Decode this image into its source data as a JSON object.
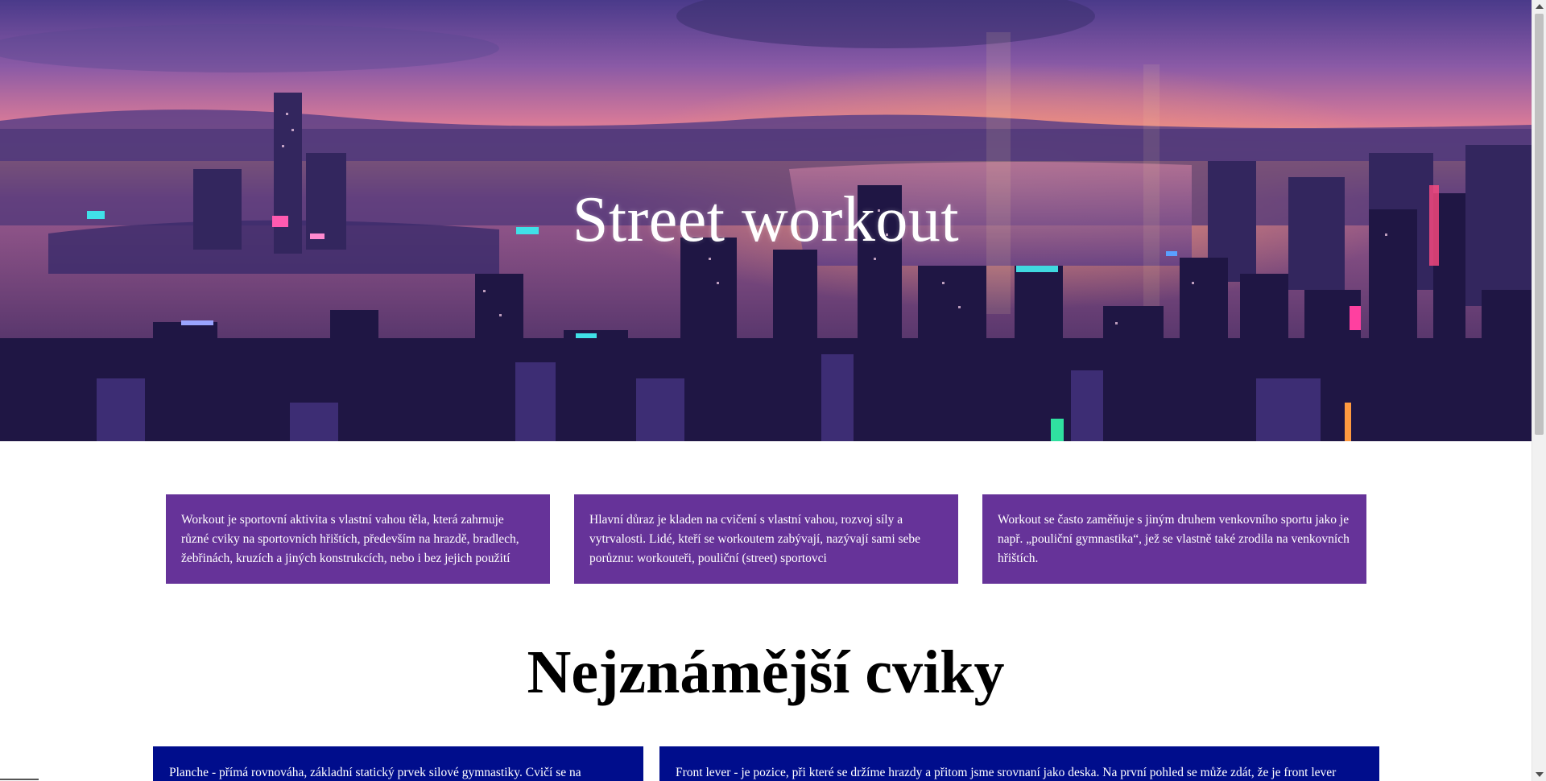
{
  "hero": {
    "title": "Street workout"
  },
  "intro_cards": [
    {
      "text": "Workout je sportovní aktivita s vlastní vahou těla, která zahrnuje různé cviky na sportovních hřištích, především na hrazdě, bradlech, žebřinách, kruzích a jiných konstrukcích, nebo i bez jejich použití"
    },
    {
      "text": "Hlavní důraz je kladen na cvičení s vlastní vahou, rozvoj síly a vytrvalosti. Lidé, kteří se workoutem zabývají, nazývají sami sebe porůznu: workouteři, pouliční (street) sportovci"
    },
    {
      "text": "Workout se často zaměňuje s jiným druhem venkovního sportu jako je např. „pouliční gymnastika“, jež se vlastně také zrodila na venkovních hřištích."
    }
  ],
  "section": {
    "title": "Nejznámější cviky"
  },
  "exercises": [
    {
      "text": "Planche - přímá rovnováha, základní statický prvek silové gymnastiky. Cvičí se na"
    },
    {
      "text": "Front lever - je pozice, při které se držíme hrazdy a přitom jsme srovnaní jako deska. Na první pohled se může zdát, že je front lever"
    }
  ],
  "colors": {
    "intro_card_bg": "#663399",
    "exercise_card_bg": "#000d8c",
    "hero_text": "#ffffff"
  }
}
